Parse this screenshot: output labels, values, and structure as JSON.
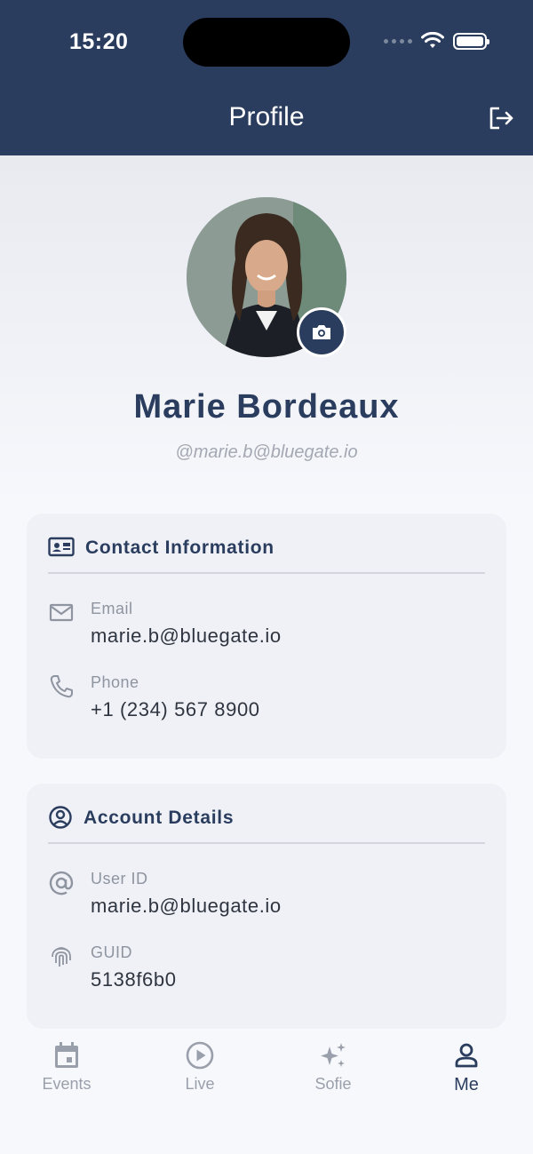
{
  "status_bar": {
    "time": "15:20"
  },
  "header": {
    "title": "Profile"
  },
  "profile": {
    "name": "Marie Bordeaux",
    "handle": "@marie.b@bluegate.io"
  },
  "contact": {
    "title": "Contact Information",
    "email_label": "Email",
    "email_value": "marie.b@bluegate.io",
    "phone_label": "Phone",
    "phone_value": "+1 (234) 567 8900"
  },
  "account": {
    "title": "Account Details",
    "userid_label": "User ID",
    "userid_value": "marie.b@bluegate.io",
    "guid_label": "GUID",
    "guid_value": "5138f6b0"
  },
  "tabs": [
    {
      "label": "Events",
      "icon": "calendar-icon"
    },
    {
      "label": "Live",
      "icon": "play-icon"
    },
    {
      "label": "Sofie",
      "icon": "sparkle-icon"
    },
    {
      "label": "Me",
      "icon": "person-icon",
      "active": true
    }
  ],
  "colors": {
    "primary": "#2b3d5e",
    "background": "#f7f8fc",
    "card": "#eff1f6"
  }
}
